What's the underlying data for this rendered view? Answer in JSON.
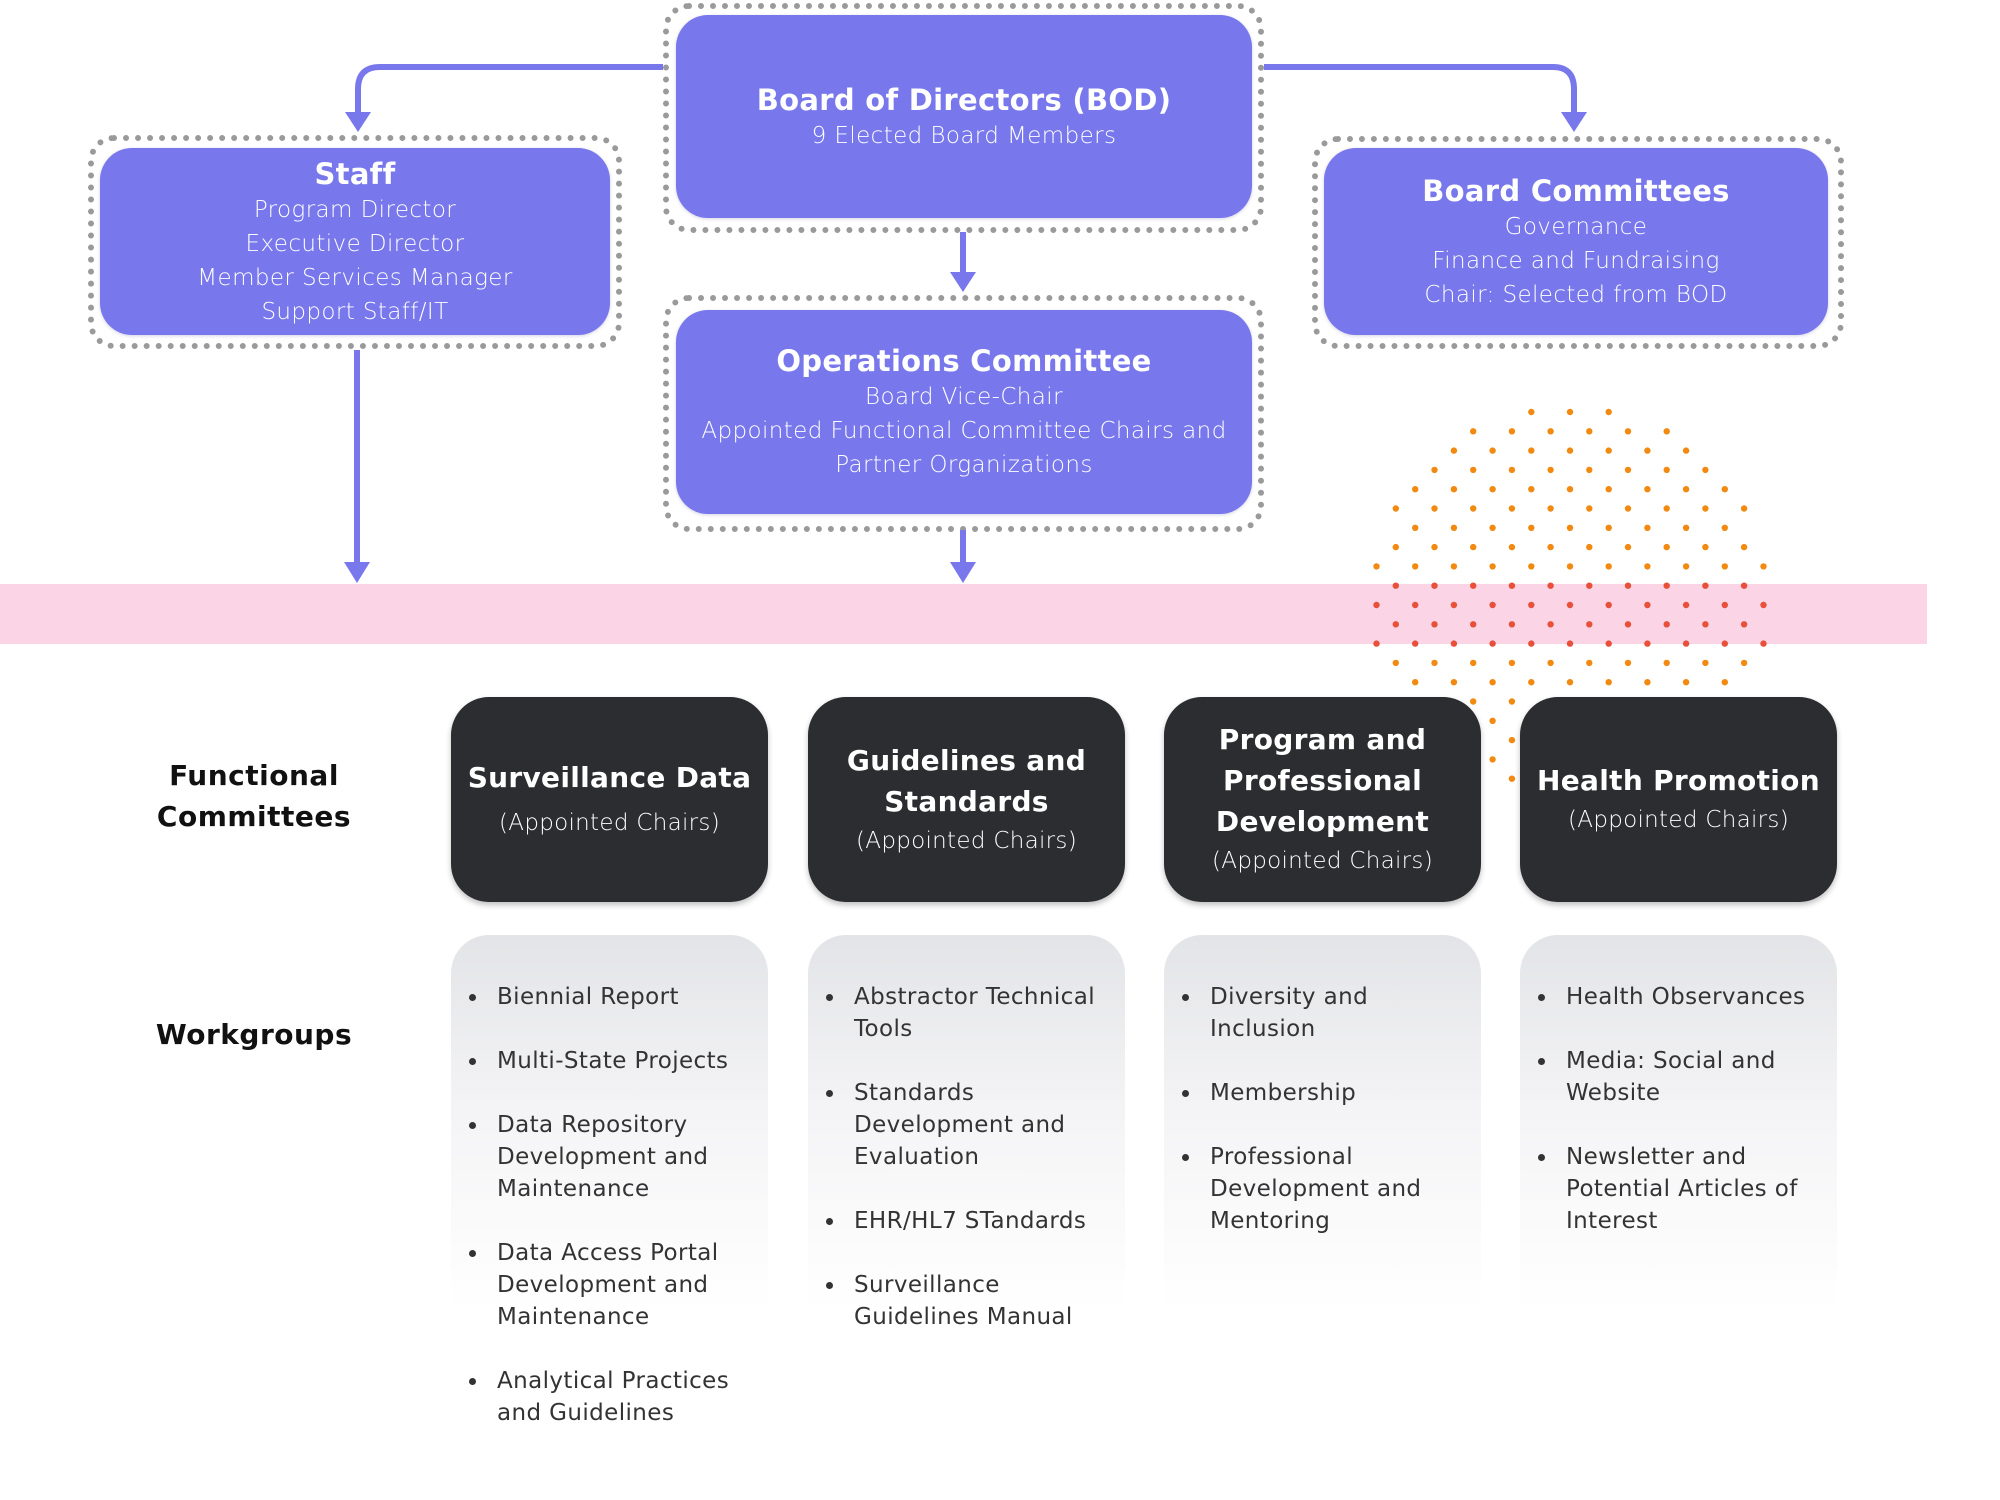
{
  "colors": {
    "primary_box": "#7878ec",
    "connector": "#7878ec",
    "dark_box": "#2c2d30",
    "band": "#fbd4e6",
    "dot_orange": "#f28a12",
    "dot_red": "#e8503a",
    "frame_dots": "#9a9a9a"
  },
  "top_nodes": {
    "bod": {
      "title": "Board of Directors (BOD)",
      "lines": [
        "9 Elected Board Members"
      ]
    },
    "staff": {
      "title": "Staff",
      "lines": [
        "Program Director",
        "Executive Director",
        "Member Services Manager",
        "Support Staff/IT"
      ]
    },
    "board_committees": {
      "title": "Board Committees",
      "lines": [
        "Governance",
        "Finance and Fundraising",
        "Chair: Selected from BOD"
      ]
    },
    "operations": {
      "title": "Operations Committee",
      "lines": [
        "Board Vice-Chair",
        "Appointed Functional Committee Chairs and",
        "Partner Organizations"
      ]
    }
  },
  "row_labels": {
    "functional_line1": "Functional",
    "functional_line2": "Committees",
    "workgroups": "Workgroups"
  },
  "functional_committees": [
    {
      "title_lines": [
        "Surveillance Data"
      ],
      "sub": "(Appointed Chairs)"
    },
    {
      "title_lines": [
        "Guidelines and",
        "Standards"
      ],
      "sub": "(Appointed Chairs)"
    },
    {
      "title_lines": [
        "Program and",
        "Professional",
        "Development"
      ],
      "sub": "(Appointed Chairs)"
    },
    {
      "title_lines": [
        "Health Promotion"
      ],
      "sub": "(Appointed Chairs)"
    }
  ],
  "workgroups": [
    {
      "items": [
        [
          "Biennial Report"
        ],
        [
          "Multi-State Projects"
        ],
        [
          "Data Repository",
          "Development and",
          "Maintenance"
        ],
        [
          "Data Access Portal",
          "Development and",
          "Maintenance"
        ],
        [
          "Analytical Practices",
          "and Guidelines"
        ]
      ]
    },
    {
      "items": [
        [
          "Abstractor Technical",
          "Tools"
        ],
        [
          "Standards",
          "Development and",
          "Evaluation"
        ],
        [
          "EHR/HL7 STandards"
        ],
        [
          "Surveillance",
          "Guidelines Manual"
        ]
      ]
    },
    {
      "items": [
        [
          "Diversity and",
          "Inclusion"
        ],
        [
          "Membership"
        ],
        [
          "Professional",
          "Development and",
          "Mentoring"
        ]
      ]
    },
    {
      "items": [
        [
          "Health Observances"
        ],
        [
          "Media: Social and",
          "Website"
        ],
        [
          "Newsletter and",
          "Potential Articles of",
          "Interest"
        ]
      ]
    }
  ]
}
